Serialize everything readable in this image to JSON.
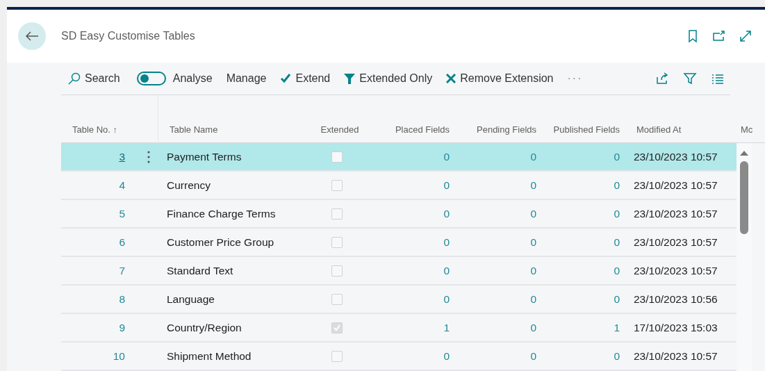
{
  "page": {
    "title": "SD Easy Customise Tables"
  },
  "toolbar": {
    "search": "Search",
    "analyse_toggle": {
      "label": "Analyse",
      "on": false
    },
    "actions": [
      {
        "kind": "menu",
        "label": "Manage"
      },
      {
        "kind": "check",
        "label": "Extend"
      },
      {
        "kind": "funnel",
        "label": "Extended Only"
      },
      {
        "kind": "cross",
        "label": "Remove Extension"
      },
      {
        "kind": "more",
        "label": "···"
      }
    ]
  },
  "table": {
    "columns": [
      {
        "label": "Table No. ↑"
      },
      {
        "label": "Table Name"
      },
      {
        "label": "Extended"
      },
      {
        "label": "Placed Fields"
      },
      {
        "label": "Pending Fields"
      },
      {
        "label": "Published Fields"
      },
      {
        "label": "Modified At"
      },
      {
        "label": "Mc"
      }
    ],
    "rows": [
      {
        "no": "3",
        "name": "Payment Terms",
        "extended": false,
        "placed": "0",
        "pending": "0",
        "published": "0",
        "modified": "23/10/2023 10:57",
        "selected": true
      },
      {
        "no": "4",
        "name": "Currency",
        "extended": false,
        "placed": "0",
        "pending": "0",
        "published": "0",
        "modified": "23/10/2023 10:57",
        "selected": false
      },
      {
        "no": "5",
        "name": "Finance Charge Terms",
        "extended": false,
        "placed": "0",
        "pending": "0",
        "published": "0",
        "modified": "23/10/2023 10:57",
        "selected": false
      },
      {
        "no": "6",
        "name": "Customer Price Group",
        "extended": false,
        "placed": "0",
        "pending": "0",
        "published": "0",
        "modified": "23/10/2023 10:57",
        "selected": false
      },
      {
        "no": "7",
        "name": "Standard Text",
        "extended": false,
        "placed": "0",
        "pending": "0",
        "published": "0",
        "modified": "23/10/2023 10:57",
        "selected": false
      },
      {
        "no": "8",
        "name": "Language",
        "extended": false,
        "placed": "0",
        "pending": "0",
        "published": "0",
        "modified": "23/10/2023 10:56",
        "selected": false
      },
      {
        "no": "9",
        "name": "Country/Region",
        "extended": true,
        "placed": "1",
        "pending": "0",
        "published": "1",
        "modified": "17/10/2023 15:03",
        "selected": false
      },
      {
        "no": "10",
        "name": "Shipment Method",
        "extended": false,
        "placed": "0",
        "pending": "0",
        "published": "0",
        "modified": "23/10/2023 10:57",
        "selected": false
      }
    ]
  }
}
